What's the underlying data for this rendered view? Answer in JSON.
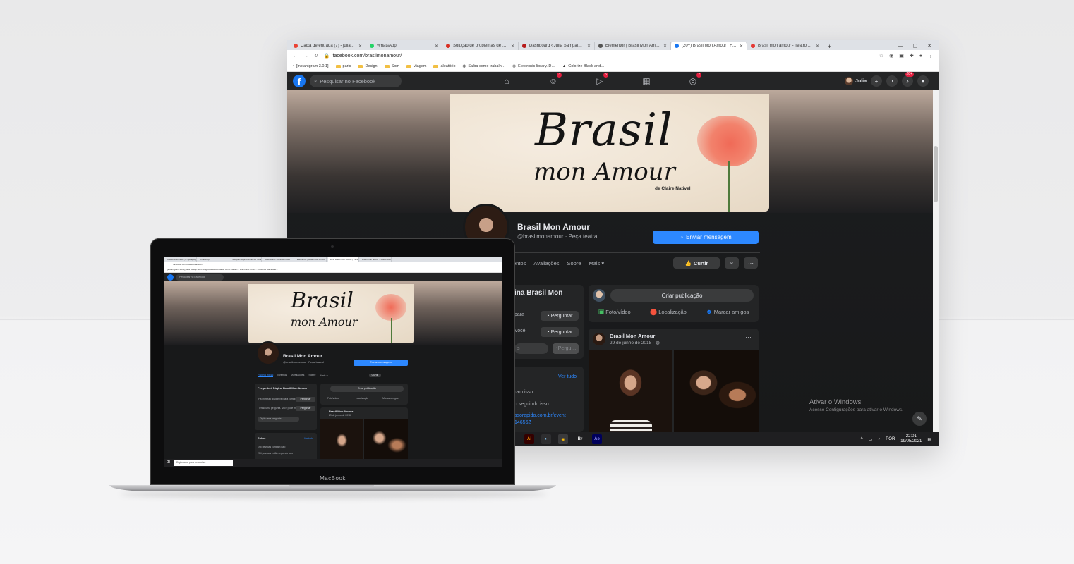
{
  "browser": {
    "tabs": [
      {
        "title": "Caixa de entrada (7) - juliaps@…",
        "color": "#ea4335"
      },
      {
        "title": "WhatsApp",
        "color": "#25d366"
      },
      {
        "title": "Solução de problemas de notifi…",
        "color": "#d93025"
      },
      {
        "title": "Dashboard ‹ Julia Sampaio — W…",
        "color": "#b71c1c"
      },
      {
        "title": "Elementor | Brasil Mon Amour",
        "color": "#555555"
      },
      {
        "title": "(20+) Brasil Mon Amour | Faceb…",
        "color": "#1877f2"
      },
      {
        "title": "Brasil mon amour - Teatro Alian…",
        "color": "#e53935"
      }
    ],
    "url": "facebook.com/brasilmonamour/",
    "bookmarks": [
      "[instantgram 3.0.1]",
      "paris",
      "Design",
      "Som",
      "Viagem",
      "aleatório",
      "Saiba como trabalh…",
      "Electronic library. D…",
      "Colorize Black and…"
    ]
  },
  "fb": {
    "search_placeholder": "Pesquisar no Facebook",
    "badges": {
      "friends": "3",
      "watch": "5",
      "groups": "2",
      "notifications": "20+"
    },
    "user_name": "Julia",
    "page_name": "Brasil Mon Amour",
    "page_handle": "@brasilmonamour · Peça teatral",
    "send_message": "Enviar mensagem",
    "tabs": [
      "entos",
      "Avaliações",
      "Sobre",
      "Mais ▾"
    ],
    "like_button": "Curtir",
    "cover": {
      "title": "Brasil",
      "subtitle": "mon Amour",
      "credit": "de Claire Nativel"
    },
    "left_card": {
      "title": "ina Brasil Mon",
      "line1": "para",
      "line2": "Você",
      "ask": "Perguntar",
      "input_tail": "s",
      "input_btn": "Pergu…"
    },
    "left_card2": {
      "see_all": "Ver tudo",
      "line1": "ram isso",
      "line2": "o seguindo isso",
      "link1": "ssorapido.com.br/event",
      "link2": "14656Z"
    },
    "composer": {
      "create_post": "Criar publicação",
      "photo": "Foto/vídeo",
      "location": "Localização",
      "tag": "Marcar amigos"
    },
    "post": {
      "author": "Brasil Mon Amour",
      "date": "29 de junho de 2018 · "
    }
  },
  "windows": {
    "activate_title": "Ativar o Windows",
    "activate_sub": "Acesse Configurações para ativar o Windows.",
    "lang": "POR",
    "time": "22:01",
    "date": "19/05/2021"
  },
  "laptop": {
    "label": "MacBook",
    "search_placeholder": "Pesquisar no Facebook",
    "page_name": "Brasil Mon Amour",
    "page_handle": "@brasilmonamour · Peça teatral",
    "send_message": "Enviar mensagem",
    "tabs": [
      "Página inicial",
      "Eventos",
      "Avaliações",
      "Sobre",
      "Mais ▾"
    ],
    "like": "Curtir",
    "ask_title": "Pergunte à Página Brasil Mon Amour",
    "ask_q1": "\"Há ingresso disponível para comprar?\"",
    "ask_q2": "\"Tenho uma pergunta. Você pode me ajudar?\"",
    "ask_btn": "Perguntar",
    "ask_input": "Digite uma pergunta",
    "about": "Sobre",
    "see_all": "Ver tudo",
    "likes": "195 pessoas curtiram isso",
    "follows": "204 pessoas estão seguindo isso",
    "create_post": "Criar publicação",
    "photo": "Foto/vídeo",
    "location": "Localização",
    "tag": "Marcar amigos",
    "post_author": "Brasil Mon Amour",
    "post_date": "29 de junho de 2018",
    "taskbar_search": "Digite aqui para pesquisar",
    "cover_title": "Brasil",
    "cover_sub": "mon Amour",
    "browser_url": "facebook.com/brasilmonamour/",
    "bookmark_strip": "[instantgram 3.0.1]  paris  Design  Som  Viagem  aleatório  Saiba como trabalh…  Electronic library…  Colorize Black and…",
    "tab_titles": [
      "Caixa de entrada (7) - juliaps@…",
      "WhatsApp",
      "Solução de problemas de notifi…",
      "Dashboard ‹ Julia Sampaio",
      "Elementor | Brasil Mon Amour",
      "(20+) Brasil Mon Amour | Faceb…",
      "Brasil mon amour - Teatro Alian…"
    ]
  }
}
